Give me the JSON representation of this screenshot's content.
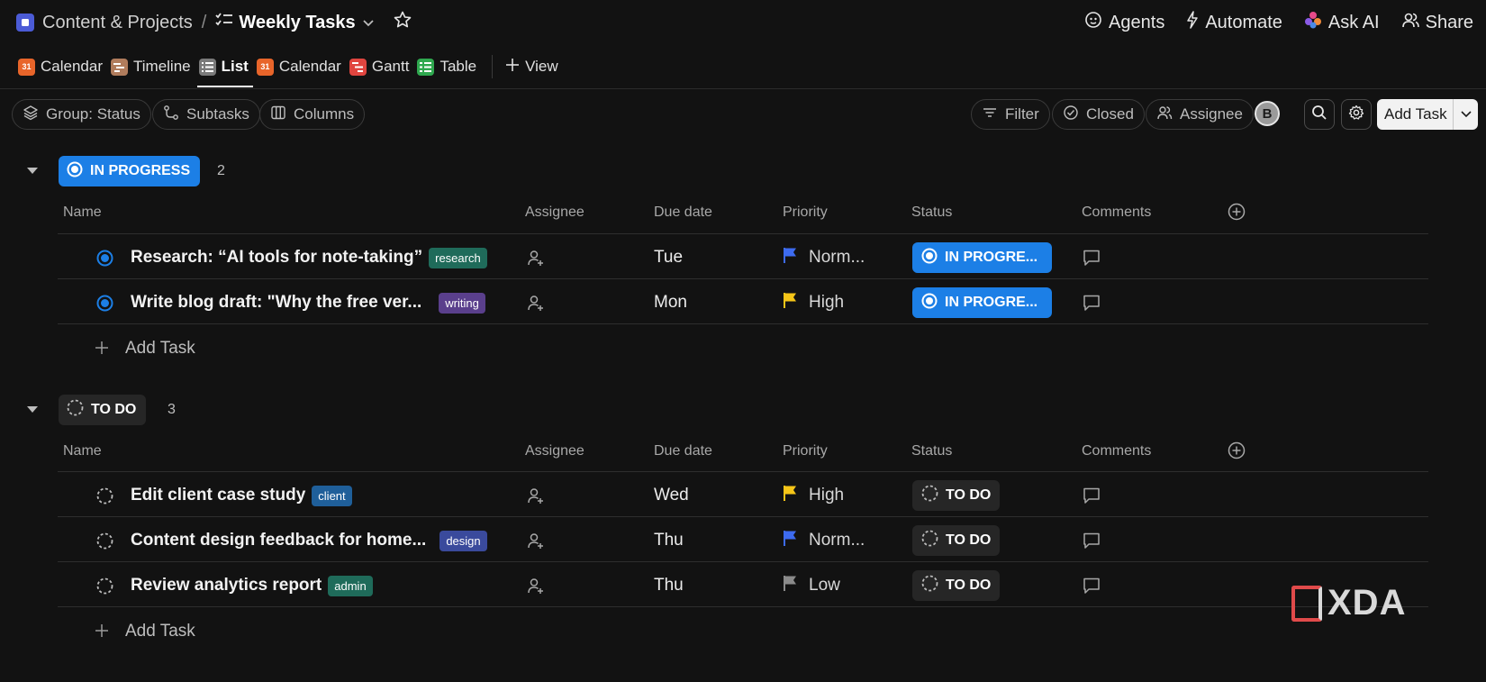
{
  "breadcrumb": {
    "space": "Content & Projects",
    "separator": "/",
    "list_title": "Weekly Tasks"
  },
  "header_actions": [
    {
      "label": "Agents",
      "icon": "agents-icon"
    },
    {
      "label": "Automate",
      "icon": "lightning-icon"
    },
    {
      "label": "Ask AI",
      "icon": "ai-sparkle-icon"
    },
    {
      "label": "Share",
      "icon": "share-users-icon"
    }
  ],
  "views": [
    {
      "label": "Calendar",
      "icon_text": "31",
      "color": "#e8652a"
    },
    {
      "label": "Timeline",
      "icon_text": "",
      "color": "#b07c5c"
    },
    {
      "label": "List",
      "icon_text": "",
      "color": "#7a7a7a",
      "active": true
    },
    {
      "label": "Calendar",
      "icon_text": "31",
      "color": "#e8652a"
    },
    {
      "label": "Gantt",
      "icon_text": "",
      "color": "#e0453f"
    },
    {
      "label": "Table",
      "icon_text": "",
      "color": "#2fa84f"
    }
  ],
  "add_view_label": "View",
  "toolbar": {
    "group_label": "Group: Status",
    "subtasks_label": "Subtasks",
    "columns_label": "Columns",
    "filter_label": "Filter",
    "closed_label": "Closed",
    "assignee_label": "Assignee",
    "avatar_initial": "B",
    "add_task_label": "Add Task"
  },
  "columns": {
    "name": "Name",
    "assignee": "Assignee",
    "due_date": "Due date",
    "priority": "Priority",
    "status": "Status",
    "comments": "Comments"
  },
  "colors": {
    "progress_blue": "#1c7fe6",
    "flag_blue": "#3d6bf0",
    "flag_yellow": "#f5c518",
    "flag_gray": "#8a8a8a"
  },
  "groups": [
    {
      "status": "IN PROGRESS",
      "count": "2",
      "tasks": [
        {
          "name": "Research: “AI tools for note-taking”",
          "tag": "research",
          "tag_color": "#1f6b5a",
          "due": "Tue",
          "priority": "Norm...",
          "flag_color": "#3d6bf0",
          "status": "IN PROGRE..."
        },
        {
          "name": "Write blog draft: \"Why the free ver...",
          "tag": "writing",
          "tag_color": "#5a3f8c",
          "due": "Mon",
          "priority": "High",
          "flag_color": "#f5c518",
          "status": "IN PROGRE..."
        }
      ],
      "add_task_label": "Add Task"
    },
    {
      "status": "TO DO",
      "count": "3",
      "tasks": [
        {
          "name": "Edit client case study",
          "tag": "client",
          "tag_color": "#1f5f9a",
          "due": "Wed",
          "priority": "High",
          "flag_color": "#f5c518",
          "status": "TO DO"
        },
        {
          "name": "Content design feedback for home...",
          "tag": "design",
          "tag_color": "#3a4a9c",
          "due": "Thu",
          "priority": "Norm...",
          "flag_color": "#3d6bf0",
          "status": "TO DO"
        },
        {
          "name": "Review analytics report",
          "tag": "admin",
          "tag_color": "#1f6b5a",
          "due": "Thu",
          "priority": "Low",
          "flag_color": "#8a8a8a",
          "status": "TO DO"
        }
      ],
      "add_task_label": "Add Task"
    }
  ],
  "watermark": "XDA"
}
